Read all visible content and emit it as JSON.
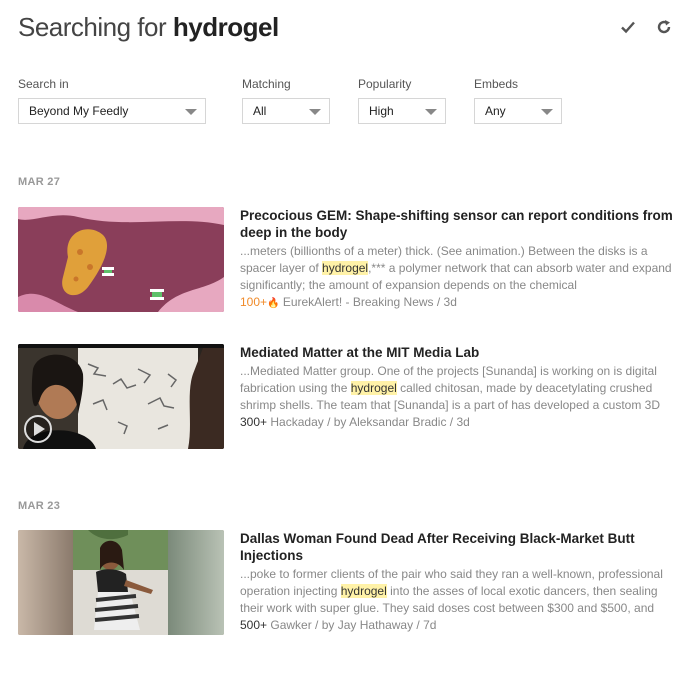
{
  "header": {
    "prefix": "Searching for",
    "query": "hydrogel",
    "icons": [
      "check-icon",
      "refresh-icon"
    ]
  },
  "filters": {
    "search_in": {
      "label": "Search in",
      "value": "Beyond My Feedly"
    },
    "matching": {
      "label": "Matching",
      "value": "All"
    },
    "popularity": {
      "label": "Popularity",
      "value": "High"
    },
    "embeds": {
      "label": "Embeds",
      "value": "Any"
    }
  },
  "groups": [
    {
      "date": "MAR 27",
      "entries": [
        {
          "title": "Precocious GEM: Shape-shifting sensor can report conditions from deep in the body",
          "snippet_before": "...meters (billionths of a meter) thick. (See animation.) Between the disks is a spacer layer of ",
          "highlight": "hydrogel",
          "snippet_after": ",*** a polymer network that can absorb water and expand significantly; the amount of expansion depends on the chemical",
          "popularity": "100+",
          "hot": true,
          "source": "EurekAlert! - Breaking News / 3d"
        },
        {
          "title": "Mediated Matter at the MIT Media Lab",
          "snippet_before": "...Mediated Matter group. One of the projects [Sunanda] is working on is digital fabrication using the ",
          "highlight": "hydrogel",
          "snippet_after": " called chitosan, made by deacetylating crushed shrimp shells. The team that [Sunanda] is a part of has developed a custom 3D",
          "popularity": "300+",
          "hot": false,
          "source": "Hackaday / by Aleksandar Bradic / 3d"
        }
      ]
    },
    {
      "date": "MAR 23",
      "entries": [
        {
          "title": "Dallas Woman Found Dead After Receiving Black-Market Butt Injections",
          "snippet_before": "...poke to former clients of the pair who said they ran a well-known, professional operation injecting ",
          "highlight": "hydrogel",
          "snippet_after": " into the asses of local exotic dancers, then sealing their work with super glue. They said doses cost between $300 and $500, and",
          "popularity": "500+",
          "hot": false,
          "source": "Gawker / by Jay Hathaway / 7d"
        }
      ]
    }
  ],
  "colors": {
    "highlight": "#fff2a8",
    "hot": "#f08b2a"
  }
}
